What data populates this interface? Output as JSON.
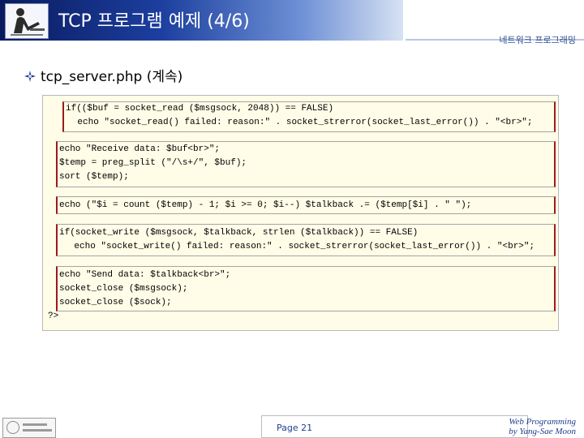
{
  "header": {
    "title": "TCP 프로그램 예제 (4/6)",
    "right_label": "네트워크 프로그래밍"
  },
  "slide": {
    "heading": "tcp_server.php (계속)"
  },
  "code": {
    "lines": [
      "if(($buf = socket_read ($msgsock, 2048)) == FALSE)",
      "    echo \"socket_read() failed: reason:\" . socket_strerror(socket_last_error()) . \"<br>\";",
      "echo \"Receive data: $buf<br>\";",
      "$temp = preg_split (\"/\\s+/\", $buf);",
      "sort ($temp);",
      "echo (\"$i = count ($temp) - 1; $i >= 0; $i--) $talkback .= ($temp[$i] . \" \");",
      "if(socket_write ($msgsock, $talkback, strlen ($talkback)) == FALSE)",
      "    echo \"socket_write() failed: reason:\" . socket_strerror(socket_last_error()) . \"<br>\";",
      "echo \"Send data: $talkback<br>\";",
      "socket_close ($msgsock);",
      "socket_close ($sock);",
      "?>"
    ]
  },
  "footer": {
    "page": "Page 21",
    "course": "Web Programming",
    "author": "by Yang-Sae Moon"
  }
}
